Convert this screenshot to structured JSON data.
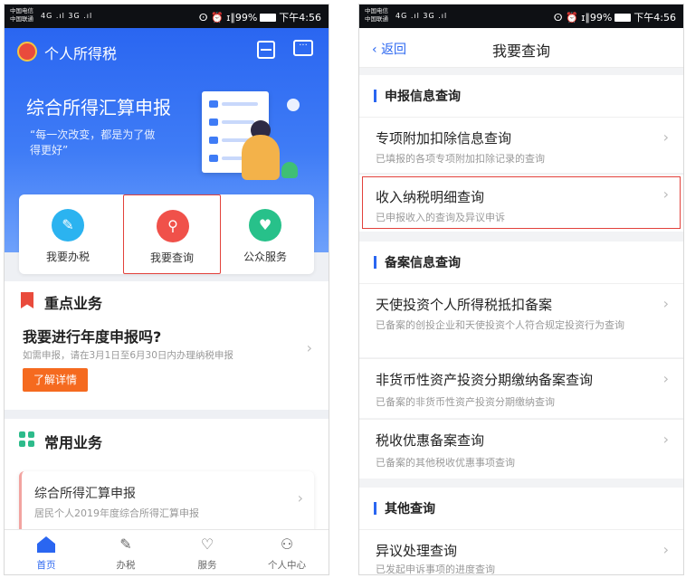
{
  "left": {
    "status": {
      "carrier1": "中国电信",
      "carrier2": "中国联通",
      "signal": "4G .ıl 3G .ıl",
      "right_text": "ⵙ ⏰ ɪ∥99%",
      "time": "下午4:56"
    },
    "header": {
      "app_title": "个人所得税"
    },
    "banner": {
      "title": "综合所得汇算申报",
      "subtitle": "“每一次改变，都是为了做得更好”"
    },
    "quick": [
      {
        "label": "我要办税",
        "color": "#2bb3f0",
        "icon": "pencil-icon"
      },
      {
        "label": "我要查询",
        "color": "#f0514a",
        "icon": "search-icon"
      },
      {
        "label": "公众服务",
        "color": "#27c18a",
        "icon": "shield-icon"
      }
    ],
    "key_business": {
      "title": "重点业务",
      "question": "我要进行年度申报吗?",
      "hint": "如需申报，请在3月1日至6月30日内办理纳税申报",
      "button": "了解详情"
    },
    "common_business": {
      "title": "常用业务",
      "item_title": "综合所得汇算申报",
      "item_sub": "居民个人2019年度综合所得汇算申报"
    },
    "tabs": [
      {
        "label": "首页",
        "icon": "home-icon"
      },
      {
        "label": "办税",
        "icon": "form-icon"
      },
      {
        "label": "服务",
        "icon": "heart-icon"
      },
      {
        "label": "个人中心",
        "icon": "user-icon"
      }
    ]
  },
  "right": {
    "status": {
      "carrier1": "中国电信",
      "carrier2": "中国联通",
      "signal": "4G .ıl 3G .ıl",
      "right_text": "ⵙ ⏰ ɪ∥99%",
      "time": "下午4:56"
    },
    "nav": {
      "back": "返回",
      "title": "我要查询"
    },
    "groups": [
      {
        "title": "申报信息查询"
      },
      {
        "title": "备案信息查询"
      },
      {
        "title": "其他查询"
      }
    ],
    "rows": [
      {
        "title": "专项附加扣除信息查询",
        "sub": "已填报的各项专项附加扣除记录的查询"
      },
      {
        "title": "收入纳税明细查询",
        "sub": "已申报收入的查询及异议申诉"
      },
      {
        "title": "天使投资个人所得税抵扣备案",
        "sub": "已备案的创投企业和天使投资个人符合规定投资行为查询"
      },
      {
        "title": "非货币性资产投资分期缴纳备案查询",
        "sub": "已备案的非货币性资产投资分期缴纳查询"
      },
      {
        "title": "税收优惠备案查询",
        "sub": "已备案的其他税收优惠事项查询"
      },
      {
        "title": "异议处理查询",
        "sub": "已发起申诉事项的进度查询"
      }
    ]
  }
}
